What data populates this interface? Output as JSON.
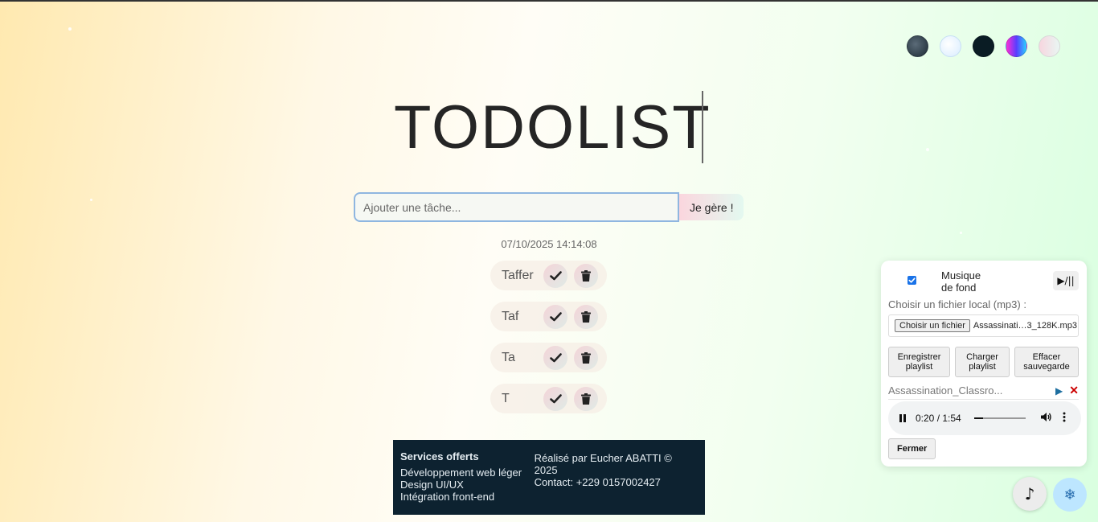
{
  "header": {
    "title": "TODOLIST"
  },
  "themes": [
    {
      "name": "dark-slate",
      "color": "#2c3b45"
    },
    {
      "name": "light-blue",
      "color": "#e8f4ff"
    },
    {
      "name": "night",
      "color": "#0a1c24"
    },
    {
      "name": "neon",
      "color": "#ff2fd6"
    },
    {
      "name": "pastel",
      "color": "#f7d6df"
    }
  ],
  "add_task": {
    "placeholder": "Ajouter une tâche...",
    "button": "Je gère !"
  },
  "datetime": "07/10/2025 14:14:08",
  "tasks": [
    {
      "text": "Taffer"
    },
    {
      "text": "Taf"
    },
    {
      "text": "Ta"
    },
    {
      "text": "T"
    }
  ],
  "footer": {
    "services_title": "Services offerts",
    "services": [
      "Développement web léger",
      "Design UI/UX",
      "Intégration front-end"
    ],
    "credit": "Réalisé par Eucher ABATTI © 2025",
    "contact": "Contact: +229 0157002427"
  },
  "music_panel": {
    "label_line1": "Musique",
    "label_line2": "de fond",
    "checked": true,
    "toggle_label": "▶/||",
    "choose_label": "Choisir un fichier local (mp3) :",
    "file_button": "Choisir un fichier",
    "file_name": "Assassinati…3_128K.mp3",
    "buttons": {
      "save_line1": "Enregistrer",
      "save_line2": "playlist",
      "load_line1": "Charger",
      "load_line2": "playlist",
      "clear_line1": "Effacer",
      "clear_line2": "sauvegarde"
    },
    "playlist_item": "Assassination_Classro...",
    "audio": {
      "time": "0:20 / 1:54",
      "progress": 0.175
    },
    "close": "Fermer"
  },
  "fab": {
    "music_icon": "♪",
    "snow_icon": "❄"
  }
}
